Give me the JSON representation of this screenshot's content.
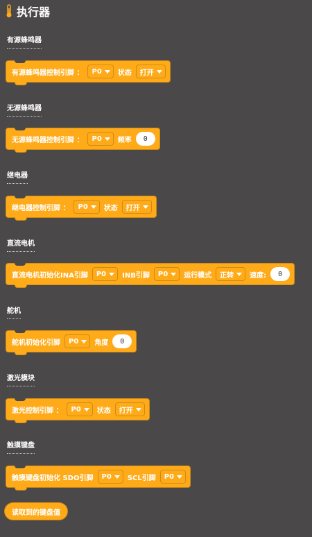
{
  "header": {
    "title": "执行器",
    "icon": "thermometer-icon",
    "accent": "#ffab19"
  },
  "sections": [
    {
      "label": "有源蜂鸣器",
      "block": {
        "parts": [
          "有源蜂鸣器控制引脚 ：",
          "状态"
        ],
        "pin": "P0",
        "state": "打开"
      }
    },
    {
      "label": "无源蜂鸣器",
      "block": {
        "parts": [
          "无源蜂鸣器控制引脚 ：",
          "频率"
        ],
        "pin": "P0",
        "frequency": "0"
      }
    },
    {
      "label": "继电器",
      "block": {
        "parts": [
          "继电器控制引脚 ：",
          "状态"
        ],
        "pin": "P0",
        "state": "打开"
      }
    },
    {
      "label": "直流电机",
      "block": {
        "parts": [
          "直流电机初始化INA引脚",
          "INB引脚",
          "运行模式",
          "速度:"
        ],
        "ina_pin": "P0",
        "inb_pin": "P0",
        "mode": "正转",
        "speed": "0"
      }
    },
    {
      "label": "舵机",
      "block": {
        "parts": [
          "舵机初始化引脚",
          "角度"
        ],
        "pin": "P0",
        "angle": "0"
      }
    },
    {
      "label": "激光模块",
      "block": {
        "parts": [
          "激光控制引脚 ：",
          "状态"
        ],
        "pin": "P0",
        "state": "打开"
      }
    },
    {
      "label": "触摸键盘",
      "block": {
        "parts": [
          "触摸键盘初始化 SDO引脚",
          "SCL引脚"
        ],
        "sdo_pin": "P0",
        "scl_pin": "P0"
      },
      "reporter": "读取到的键盘值"
    }
  ],
  "colors": {
    "background": "#4a4849",
    "block": "#ffab19",
    "block_border": "#cf8b17"
  }
}
